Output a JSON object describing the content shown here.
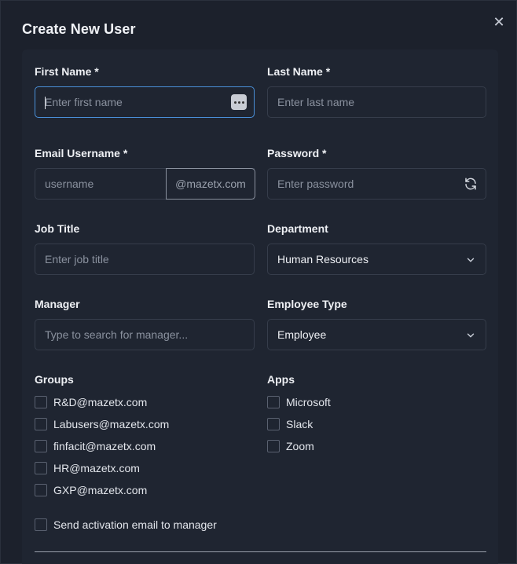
{
  "dialog": {
    "title": "Create New User",
    "close_glyph": "✕"
  },
  "form": {
    "first_name": {
      "label": "First Name *",
      "placeholder": "Enter first name",
      "value": ""
    },
    "last_name": {
      "label": "Last Name *",
      "placeholder": "Enter last name",
      "value": ""
    },
    "email": {
      "label": "Email Username *",
      "placeholder": "username",
      "suffix": "@mazetx.com",
      "value": ""
    },
    "password": {
      "label": "Password *",
      "placeholder": "Enter password",
      "value": ""
    },
    "job_title": {
      "label": "Job Title",
      "placeholder": "Enter job title",
      "value": ""
    },
    "department": {
      "label": "Department",
      "selected": "Human Resources"
    },
    "manager": {
      "label": "Manager",
      "placeholder": "Type to search for manager...",
      "value": ""
    },
    "employee_type": {
      "label": "Employee Type",
      "selected": "Employee"
    },
    "groups": {
      "label": "Groups",
      "items": [
        "R&D@mazetx.com",
        "Labusers@mazetx.com",
        "finfacit@mazetx.com",
        "HR@mazetx.com",
        "GXP@mazetx.com"
      ]
    },
    "apps": {
      "label": "Apps",
      "items": [
        "Microsoft",
        "Slack",
        "Zoom"
      ]
    },
    "send_activation": {
      "label": "Send activation email to manager",
      "checked": false
    }
  },
  "colors": {
    "background": "#1c212c",
    "panel": "#1f2531",
    "focus_border": "#4a90d9",
    "field_border": "#363d4b"
  }
}
